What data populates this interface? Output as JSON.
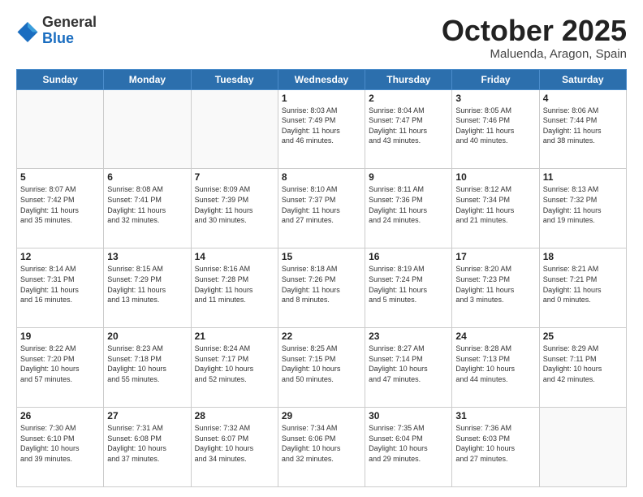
{
  "header": {
    "logo_general": "General",
    "logo_blue": "Blue",
    "month_title": "October 2025",
    "subtitle": "Maluenda, Aragon, Spain"
  },
  "weekdays": [
    "Sunday",
    "Monday",
    "Tuesday",
    "Wednesday",
    "Thursday",
    "Friday",
    "Saturday"
  ],
  "weeks": [
    [
      {
        "day": "",
        "info": ""
      },
      {
        "day": "",
        "info": ""
      },
      {
        "day": "",
        "info": ""
      },
      {
        "day": "1",
        "info": "Sunrise: 8:03 AM\nSunset: 7:49 PM\nDaylight: 11 hours\nand 46 minutes."
      },
      {
        "day": "2",
        "info": "Sunrise: 8:04 AM\nSunset: 7:47 PM\nDaylight: 11 hours\nand 43 minutes."
      },
      {
        "day": "3",
        "info": "Sunrise: 8:05 AM\nSunset: 7:46 PM\nDaylight: 11 hours\nand 40 minutes."
      },
      {
        "day": "4",
        "info": "Sunrise: 8:06 AM\nSunset: 7:44 PM\nDaylight: 11 hours\nand 38 minutes."
      }
    ],
    [
      {
        "day": "5",
        "info": "Sunrise: 8:07 AM\nSunset: 7:42 PM\nDaylight: 11 hours\nand 35 minutes."
      },
      {
        "day": "6",
        "info": "Sunrise: 8:08 AM\nSunset: 7:41 PM\nDaylight: 11 hours\nand 32 minutes."
      },
      {
        "day": "7",
        "info": "Sunrise: 8:09 AM\nSunset: 7:39 PM\nDaylight: 11 hours\nand 30 minutes."
      },
      {
        "day": "8",
        "info": "Sunrise: 8:10 AM\nSunset: 7:37 PM\nDaylight: 11 hours\nand 27 minutes."
      },
      {
        "day": "9",
        "info": "Sunrise: 8:11 AM\nSunset: 7:36 PM\nDaylight: 11 hours\nand 24 minutes."
      },
      {
        "day": "10",
        "info": "Sunrise: 8:12 AM\nSunset: 7:34 PM\nDaylight: 11 hours\nand 21 minutes."
      },
      {
        "day": "11",
        "info": "Sunrise: 8:13 AM\nSunset: 7:32 PM\nDaylight: 11 hours\nand 19 minutes."
      }
    ],
    [
      {
        "day": "12",
        "info": "Sunrise: 8:14 AM\nSunset: 7:31 PM\nDaylight: 11 hours\nand 16 minutes."
      },
      {
        "day": "13",
        "info": "Sunrise: 8:15 AM\nSunset: 7:29 PM\nDaylight: 11 hours\nand 13 minutes."
      },
      {
        "day": "14",
        "info": "Sunrise: 8:16 AM\nSunset: 7:28 PM\nDaylight: 11 hours\nand 11 minutes."
      },
      {
        "day": "15",
        "info": "Sunrise: 8:18 AM\nSunset: 7:26 PM\nDaylight: 11 hours\nand 8 minutes."
      },
      {
        "day": "16",
        "info": "Sunrise: 8:19 AM\nSunset: 7:24 PM\nDaylight: 11 hours\nand 5 minutes."
      },
      {
        "day": "17",
        "info": "Sunrise: 8:20 AM\nSunset: 7:23 PM\nDaylight: 11 hours\nand 3 minutes."
      },
      {
        "day": "18",
        "info": "Sunrise: 8:21 AM\nSunset: 7:21 PM\nDaylight: 11 hours\nand 0 minutes."
      }
    ],
    [
      {
        "day": "19",
        "info": "Sunrise: 8:22 AM\nSunset: 7:20 PM\nDaylight: 10 hours\nand 57 minutes."
      },
      {
        "day": "20",
        "info": "Sunrise: 8:23 AM\nSunset: 7:18 PM\nDaylight: 10 hours\nand 55 minutes."
      },
      {
        "day": "21",
        "info": "Sunrise: 8:24 AM\nSunset: 7:17 PM\nDaylight: 10 hours\nand 52 minutes."
      },
      {
        "day": "22",
        "info": "Sunrise: 8:25 AM\nSunset: 7:15 PM\nDaylight: 10 hours\nand 50 minutes."
      },
      {
        "day": "23",
        "info": "Sunrise: 8:27 AM\nSunset: 7:14 PM\nDaylight: 10 hours\nand 47 minutes."
      },
      {
        "day": "24",
        "info": "Sunrise: 8:28 AM\nSunset: 7:13 PM\nDaylight: 10 hours\nand 44 minutes."
      },
      {
        "day": "25",
        "info": "Sunrise: 8:29 AM\nSunset: 7:11 PM\nDaylight: 10 hours\nand 42 minutes."
      }
    ],
    [
      {
        "day": "26",
        "info": "Sunrise: 7:30 AM\nSunset: 6:10 PM\nDaylight: 10 hours\nand 39 minutes."
      },
      {
        "day": "27",
        "info": "Sunrise: 7:31 AM\nSunset: 6:08 PM\nDaylight: 10 hours\nand 37 minutes."
      },
      {
        "day": "28",
        "info": "Sunrise: 7:32 AM\nSunset: 6:07 PM\nDaylight: 10 hours\nand 34 minutes."
      },
      {
        "day": "29",
        "info": "Sunrise: 7:34 AM\nSunset: 6:06 PM\nDaylight: 10 hours\nand 32 minutes."
      },
      {
        "day": "30",
        "info": "Sunrise: 7:35 AM\nSunset: 6:04 PM\nDaylight: 10 hours\nand 29 minutes."
      },
      {
        "day": "31",
        "info": "Sunrise: 7:36 AM\nSunset: 6:03 PM\nDaylight: 10 hours\nand 27 minutes."
      },
      {
        "day": "",
        "info": ""
      }
    ]
  ]
}
